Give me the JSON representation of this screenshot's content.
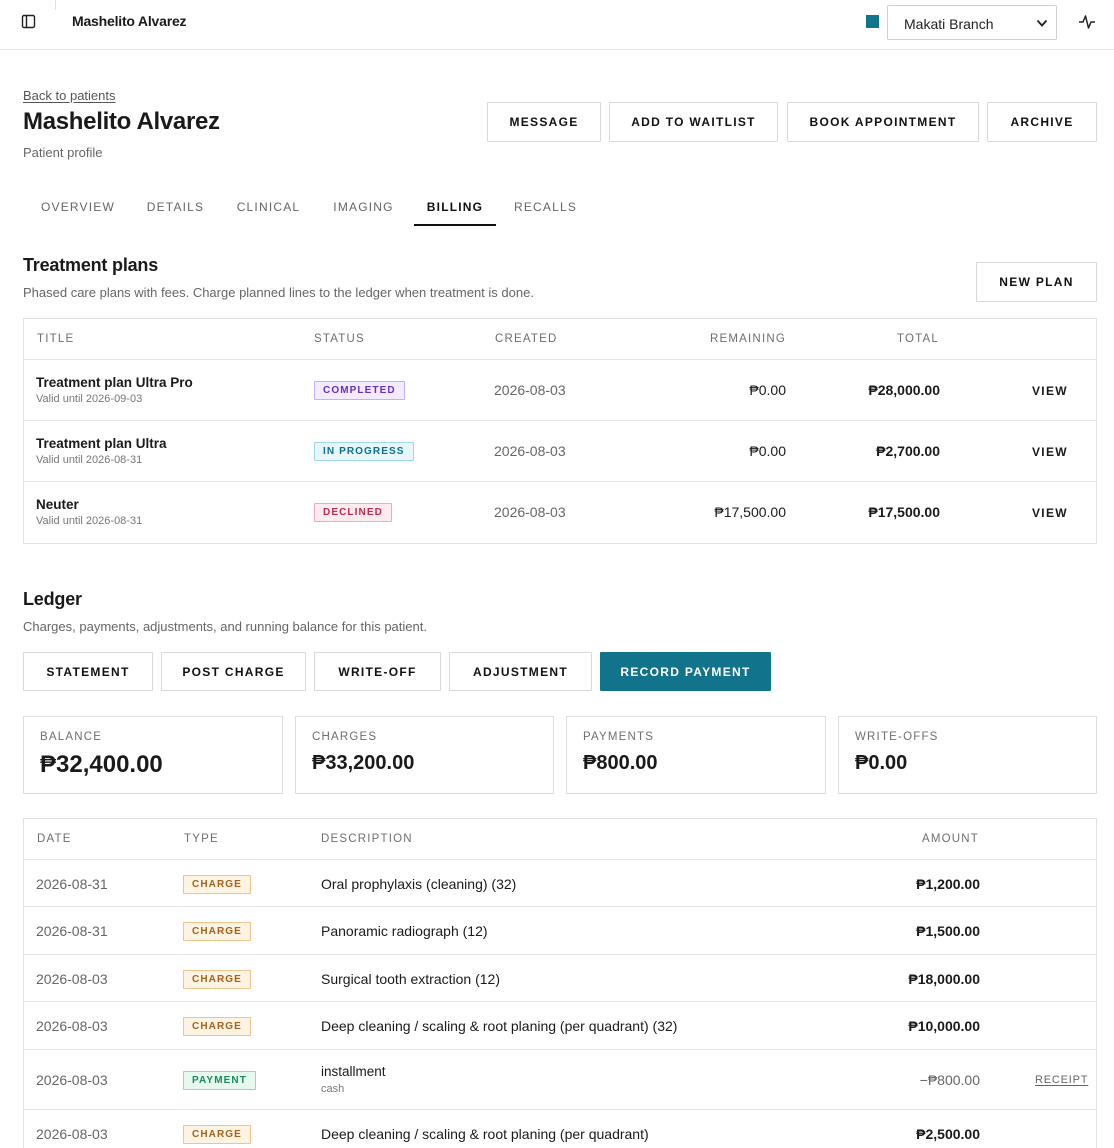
{
  "topbar": {
    "title": "Mashelito Alvarez",
    "branch": "Makati Branch",
    "branch_color": "#12748c"
  },
  "header": {
    "back_link": "Back to patients",
    "title": "Mashelito Alvarez",
    "subtitle": "Patient profile",
    "actions": {
      "message": "MESSAGE",
      "waitlist": "ADD TO WAITLIST",
      "book": "BOOK APPOINTMENT",
      "archive": "ARCHIVE"
    }
  },
  "tabs": [
    {
      "label": "OVERVIEW"
    },
    {
      "label": "DETAILS"
    },
    {
      "label": "CLINICAL"
    },
    {
      "label": "IMAGING"
    },
    {
      "label": "BILLING",
      "active": true
    },
    {
      "label": "RECALLS"
    }
  ],
  "treatment_plans": {
    "title": "Treatment plans",
    "subtitle": "Phased care plans with fees. Charge planned lines to the ledger when treatment is done.",
    "new_plan": "NEW PLAN",
    "columns": {
      "title": "TITLE",
      "status": "STATUS",
      "created": "CREATED",
      "remaining": "REMAINING",
      "total": "TOTAL"
    },
    "rows": [
      {
        "title": "Treatment plan Ultra Pro",
        "valid": "Valid until 2026-09-03",
        "status": "COMPLETED",
        "created": "2026-08-03",
        "remaining": "₱0.00",
        "total": "₱28,000.00",
        "action": "VIEW"
      },
      {
        "title": "Treatment plan Ultra",
        "valid": "Valid until 2026-08-31",
        "status": "IN PROGRESS",
        "created": "2026-08-03",
        "remaining": "₱0.00",
        "total": "₱2,700.00",
        "action": "VIEW"
      },
      {
        "title": "Neuter",
        "valid": "Valid until 2026-08-31",
        "status": "DECLINED",
        "created": "2026-08-03",
        "remaining": "₱17,500.00",
        "total": "₱17,500.00",
        "action": "VIEW"
      }
    ]
  },
  "ledger": {
    "title": "Ledger",
    "subtitle": "Charges, payments, adjustments, and running balance for this patient.",
    "actions": {
      "statement": "STATEMENT",
      "post_charge": "POST CHARGE",
      "write_off": "WRITE-OFF",
      "adjustment": "ADJUSTMENT",
      "record_payment": "RECORD PAYMENT"
    },
    "stats": {
      "balance_label": "BALANCE",
      "balance": "₱32,400.00",
      "charges_label": "CHARGES",
      "charges": "₱33,200.00",
      "payments_label": "PAYMENTS",
      "payments": "₱800.00",
      "writeoffs_label": "WRITE-OFFS",
      "writeoffs": "₱0.00"
    },
    "columns": {
      "date": "DATE",
      "type": "TYPE",
      "description": "DESCRIPTION",
      "amount": "AMOUNT"
    },
    "rows": [
      {
        "date": "2026-08-31",
        "type": "CHARGE",
        "description": "Oral prophylaxis (cleaning) (32)",
        "amount": "₱1,200.00"
      },
      {
        "date": "2026-08-31",
        "type": "CHARGE",
        "description": "Panoramic radiograph (12)",
        "amount": "₱1,500.00"
      },
      {
        "date": "2026-08-03",
        "type": "CHARGE",
        "description": "Surgical tooth extraction (12)",
        "amount": "₱18,000.00"
      },
      {
        "date": "2026-08-03",
        "type": "CHARGE",
        "description": "Deep cleaning / scaling & root planing (per quadrant) (32)",
        "amount": "₱10,000.00"
      },
      {
        "date": "2026-08-03",
        "type": "PAYMENT",
        "description": "installment",
        "method": "cash",
        "amount": "−₱800.00",
        "action": "RECEIPT"
      },
      {
        "date": "2026-08-03",
        "type": "CHARGE",
        "description": "Deep cleaning / scaling & root planing (per quadrant)",
        "amount": "₱2,500.00"
      }
    ]
  }
}
